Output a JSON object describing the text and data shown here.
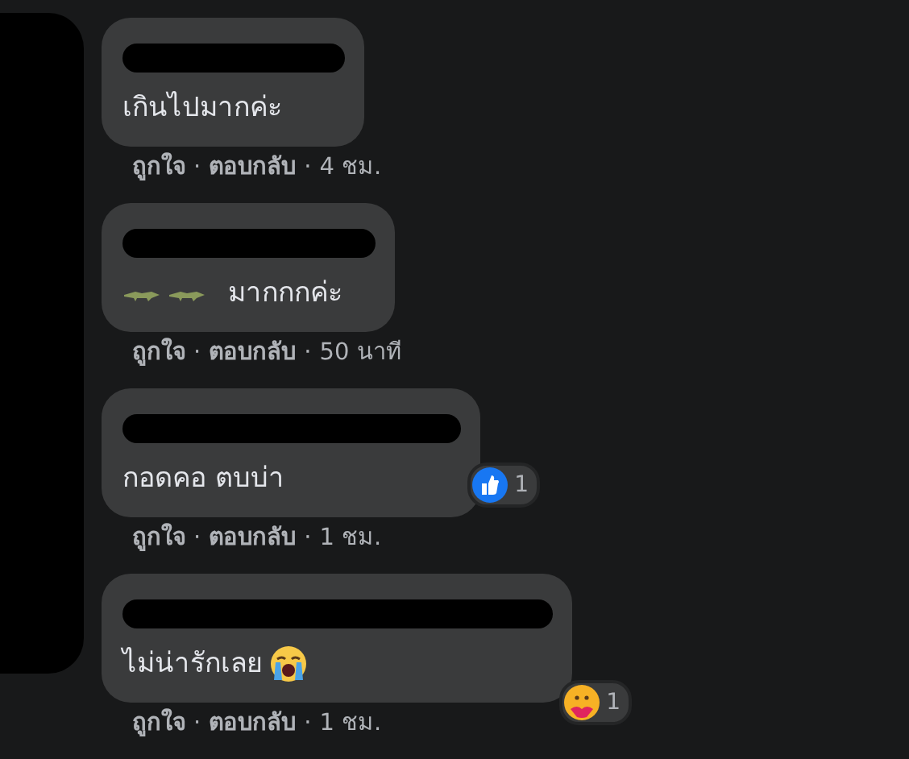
{
  "comments": [
    {
      "kind": "plain",
      "text": "เกินไปมากค่ะ",
      "actions": {
        "like": "ถูกใจ",
        "reply": "ตอบกลับ",
        "separator_1": "·",
        "separator_2": "·",
        "time": "4 ชม."
      }
    },
    {
      "kind": "lead-icons",
      "text": "มากกกค่ะ",
      "actions": {
        "like": "ถูกใจ",
        "reply": "ตอบกลับ",
        "separator_1": "·",
        "separator_2": "·",
        "time": "50 นาที"
      }
    },
    {
      "kind": "plain",
      "text": "กอดคอ ตบบ่า",
      "reaction": {
        "kind": "like",
        "count": "1"
      },
      "actions": {
        "like": "ถูกใจ",
        "reply": "ตอบกลับ",
        "separator_1": "·",
        "separator_2": "·",
        "time": "1 ชม."
      }
    },
    {
      "kind": "trail-icon",
      "text": "ไม่น่ารักเลย",
      "reaction": {
        "kind": "care",
        "count": "1"
      },
      "actions": {
        "like": "ถูกใจ",
        "reply": "ตอบกลับ",
        "separator_1": "·",
        "separator_2": "·",
        "time": "1 ชม."
      }
    }
  ]
}
